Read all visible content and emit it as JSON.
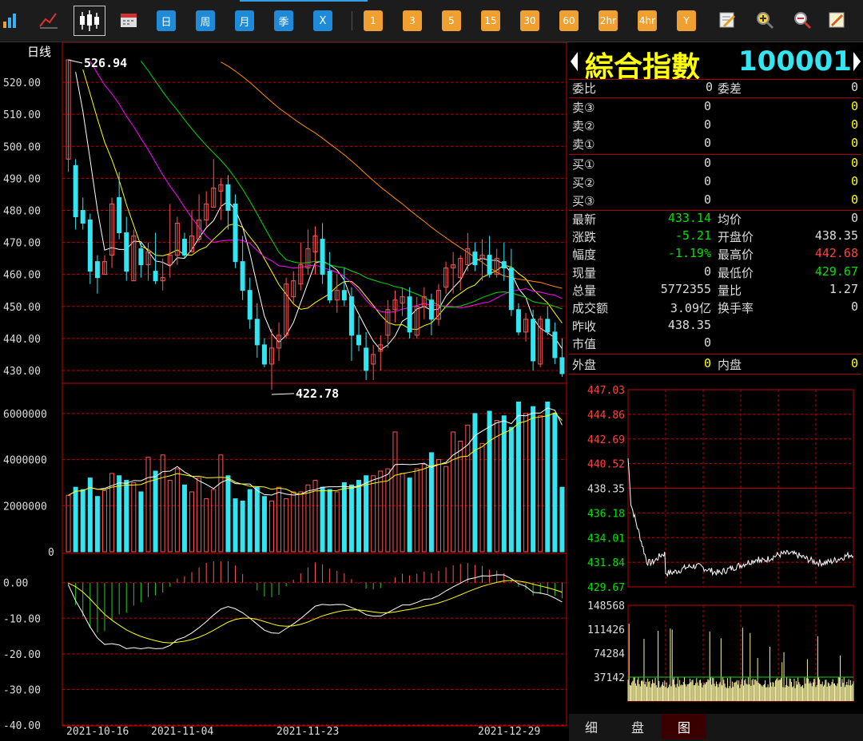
{
  "toolbar": {
    "period_buttons": [
      "日",
      "周",
      "月",
      "季",
      "X"
    ],
    "minute_buttons": [
      "1",
      "3",
      "5",
      "15",
      "30",
      "60",
      "2hr",
      "4hr",
      "Y"
    ]
  },
  "chart": {
    "period_label": "日线",
    "high_label": "526.94",
    "low_label": "422.78",
    "price_ticks": [
      "520.00",
      "510.00",
      "500.00",
      "490.00",
      "480.00",
      "470.00",
      "460.00",
      "450.00",
      "440.00",
      "430.00"
    ],
    "volume_ticks": [
      "6000000",
      "4000000",
      "2000000",
      "0"
    ],
    "macd_ticks": [
      "0.00",
      "-10.00",
      "-20.00",
      "-30.00",
      "-40.00"
    ],
    "dates": [
      "2021-10-16",
      "2021-11-04",
      "2021-11-23",
      "2021-12-29"
    ],
    "colors": {
      "up": "#ff5555",
      "down": "#33e5f0",
      "ma5": "#ffffff",
      "ma10": "#ffff00",
      "ma20": "#ff00ff",
      "ma30": "#00dd00",
      "ma60": "#ff8c00",
      "grid": "#c00000"
    }
  },
  "chart_data": {
    "type": "candlestick",
    "ylim": [
      426,
      527
    ],
    "candles": [
      [
        496,
        527,
        492,
        527
      ],
      [
        494,
        496,
        474,
        478
      ],
      [
        480,
        484,
        474,
        476
      ],
      [
        477,
        479,
        457,
        461
      ],
      [
        464,
        466,
        454,
        459
      ],
      [
        460,
        466,
        460,
        464
      ],
      [
        466,
        484,
        462,
        482
      ],
      [
        484,
        492,
        471,
        473
      ],
      [
        473,
        478,
        458,
        461
      ],
      [
        458,
        474,
        458,
        472
      ],
      [
        468,
        470,
        459,
        463
      ],
      [
        463,
        470,
        458,
        467
      ],
      [
        461,
        473,
        457,
        458
      ],
      [
        458,
        465,
        455,
        459
      ],
      [
        463,
        482,
        459,
        466
      ],
      [
        466,
        478,
        463,
        476
      ],
      [
        471,
        473,
        465,
        466
      ],
      [
        467,
        480,
        467,
        472
      ],
      [
        471,
        485,
        470,
        477
      ],
      [
        477,
        486,
        475,
        482
      ],
      [
        481,
        496,
        481,
        487
      ],
      [
        486,
        490,
        477,
        488
      ],
      [
        488,
        491,
        474,
        480
      ],
      [
        482,
        485,
        462,
        464
      ],
      [
        464,
        472,
        452,
        455
      ],
      [
        455,
        459,
        443,
        446
      ],
      [
        446,
        451,
        434,
        438
      ],
      [
        438,
        440,
        431,
        432
      ],
      [
        432,
        443,
        424,
        437
      ],
      [
        437,
        445,
        433,
        441
      ],
      [
        441,
        459,
        440,
        457
      ],
      [
        453,
        461,
        451,
        458
      ],
      [
        457,
        470,
        455,
        463
      ],
      [
        462,
        474,
        460,
        468
      ],
      [
        467,
        475,
        460,
        472
      ],
      [
        471,
        476,
        457,
        460
      ],
      [
        461,
        467,
        451,
        452
      ],
      [
        452,
        460,
        448,
        455
      ],
      [
        455,
        462,
        450,
        452
      ],
      [
        453,
        456,
        433,
        441
      ],
      [
        441,
        447,
        436,
        438
      ],
      [
        437,
        442,
        427,
        430
      ],
      [
        432,
        438,
        427,
        435
      ],
      [
        436,
        441,
        430,
        438
      ],
      [
        441,
        452,
        437,
        449
      ],
      [
        449,
        455,
        445,
        452
      ],
      [
        451,
        456,
        447,
        453
      ],
      [
        453,
        456,
        440,
        442
      ],
      [
        441,
        453,
        440,
        450
      ],
      [
        450,
        456,
        446,
        453
      ],
      [
        452,
        454,
        441,
        446
      ],
      [
        446,
        457,
        444,
        455
      ],
      [
        456,
        464,
        454,
        462
      ],
      [
        462,
        467,
        454,
        463
      ],
      [
        459,
        466,
        455,
        465
      ],
      [
        463,
        473,
        461,
        468
      ],
      [
        467,
        470,
        461,
        463
      ],
      [
        465,
        471,
        458,
        466
      ],
      [
        466,
        472,
        459,
        460
      ],
      [
        460,
        468,
        459,
        465
      ],
      [
        464,
        470,
        458,
        462
      ],
      [
        462,
        468,
        447,
        449
      ],
      [
        449,
        451,
        441,
        442
      ],
      [
        442,
        448,
        439,
        446
      ],
      [
        446,
        449,
        430,
        433
      ],
      [
        432,
        447,
        431,
        446
      ],
      [
        446,
        450,
        441,
        442
      ],
      [
        442,
        445,
        432,
        434
      ],
      [
        434,
        440,
        428,
        429
      ]
    ],
    "volume": [
      2450000,
      2800000,
      2700000,
      3200000,
      2400000,
      2650000,
      3400000,
      3300000,
      3100000,
      3000000,
      2600000,
      4100000,
      3500000,
      4200000,
      3100000,
      3600000,
      2900000,
      2600000,
      3200000,
      2300000,
      2700000,
      4200000,
      3300000,
      2300000,
      2200000,
      2700000,
      2800000,
      2400000,
      2200000,
      2800000,
      2300000,
      2600000,
      2600000,
      2900000,
      3100000,
      2800000,
      2700000,
      2600000,
      3000000,
      2900000,
      3100000,
      3300000,
      3300000,
      3500000,
      3600000,
      5200000,
      3400000,
      3200000,
      3600000,
      3800000,
      4300000,
      4000000,
      3700000,
      5200000,
      4800000,
      5500000,
      6000000,
      4700000,
      6100000,
      5700000,
      5900000,
      5400000,
      6500000,
      6000000,
      6300000,
      5900000,
      6500000,
      6000000,
      2800000,
      3500000
    ],
    "macd_ylim": [
      -40,
      6
    ]
  },
  "quote": {
    "name": "綜合指數",
    "code": "100001",
    "weibi_label": "委比",
    "weibi": "0",
    "weicha_label": "委差",
    "weicha": "0",
    "sells": [
      {
        "label": "卖③",
        "price": "0",
        "vol": "0"
      },
      {
        "label": "卖②",
        "price": "0",
        "vol": "0"
      },
      {
        "label": "卖①",
        "price": "0",
        "vol": "0"
      }
    ],
    "buys": [
      {
        "label": "买①",
        "price": "0",
        "vol": "0"
      },
      {
        "label": "买②",
        "price": "0",
        "vol": "0"
      },
      {
        "label": "买③",
        "price": "0",
        "vol": "0"
      }
    ],
    "latest_label": "最新",
    "latest": "433.14",
    "avg_label": "均价",
    "avg": "0",
    "change_label": "涨跌",
    "change": "-5.21",
    "open_label": "开盘价",
    "open": "438.35",
    "pct_label": "幅度",
    "pct": "-1.19%",
    "high_label": "最高价",
    "high": "442.68",
    "cur_vol_label": "现量",
    "cur_vol": "0",
    "low_label": "最低价",
    "low": "429.67",
    "total_vol_label": "总量",
    "total_vol": "5772355",
    "vol_ratio_label": "量比",
    "vol_ratio": "1.27",
    "amount_label": "成交额",
    "amount": "3.09亿",
    "turnover_label": "换手率",
    "turnover": "0",
    "prev_close_label": "昨收",
    "prev_close": "438.35",
    "mktcap_label": "市值",
    "mktcap": "0",
    "outer_label": "外盘",
    "outer": "0",
    "inner_label": "内盘",
    "inner": "0"
  },
  "intraday": {
    "price_ticks": [
      "447.03",
      "444.86",
      "442.69",
      "440.52",
      "438.35",
      "436.18",
      "434.01",
      "431.84",
      "429.67"
    ],
    "vol_ticks": [
      "148568",
      "111426",
      "74284",
      "37142"
    ]
  },
  "tabs": [
    "细",
    "盘",
    "图"
  ]
}
